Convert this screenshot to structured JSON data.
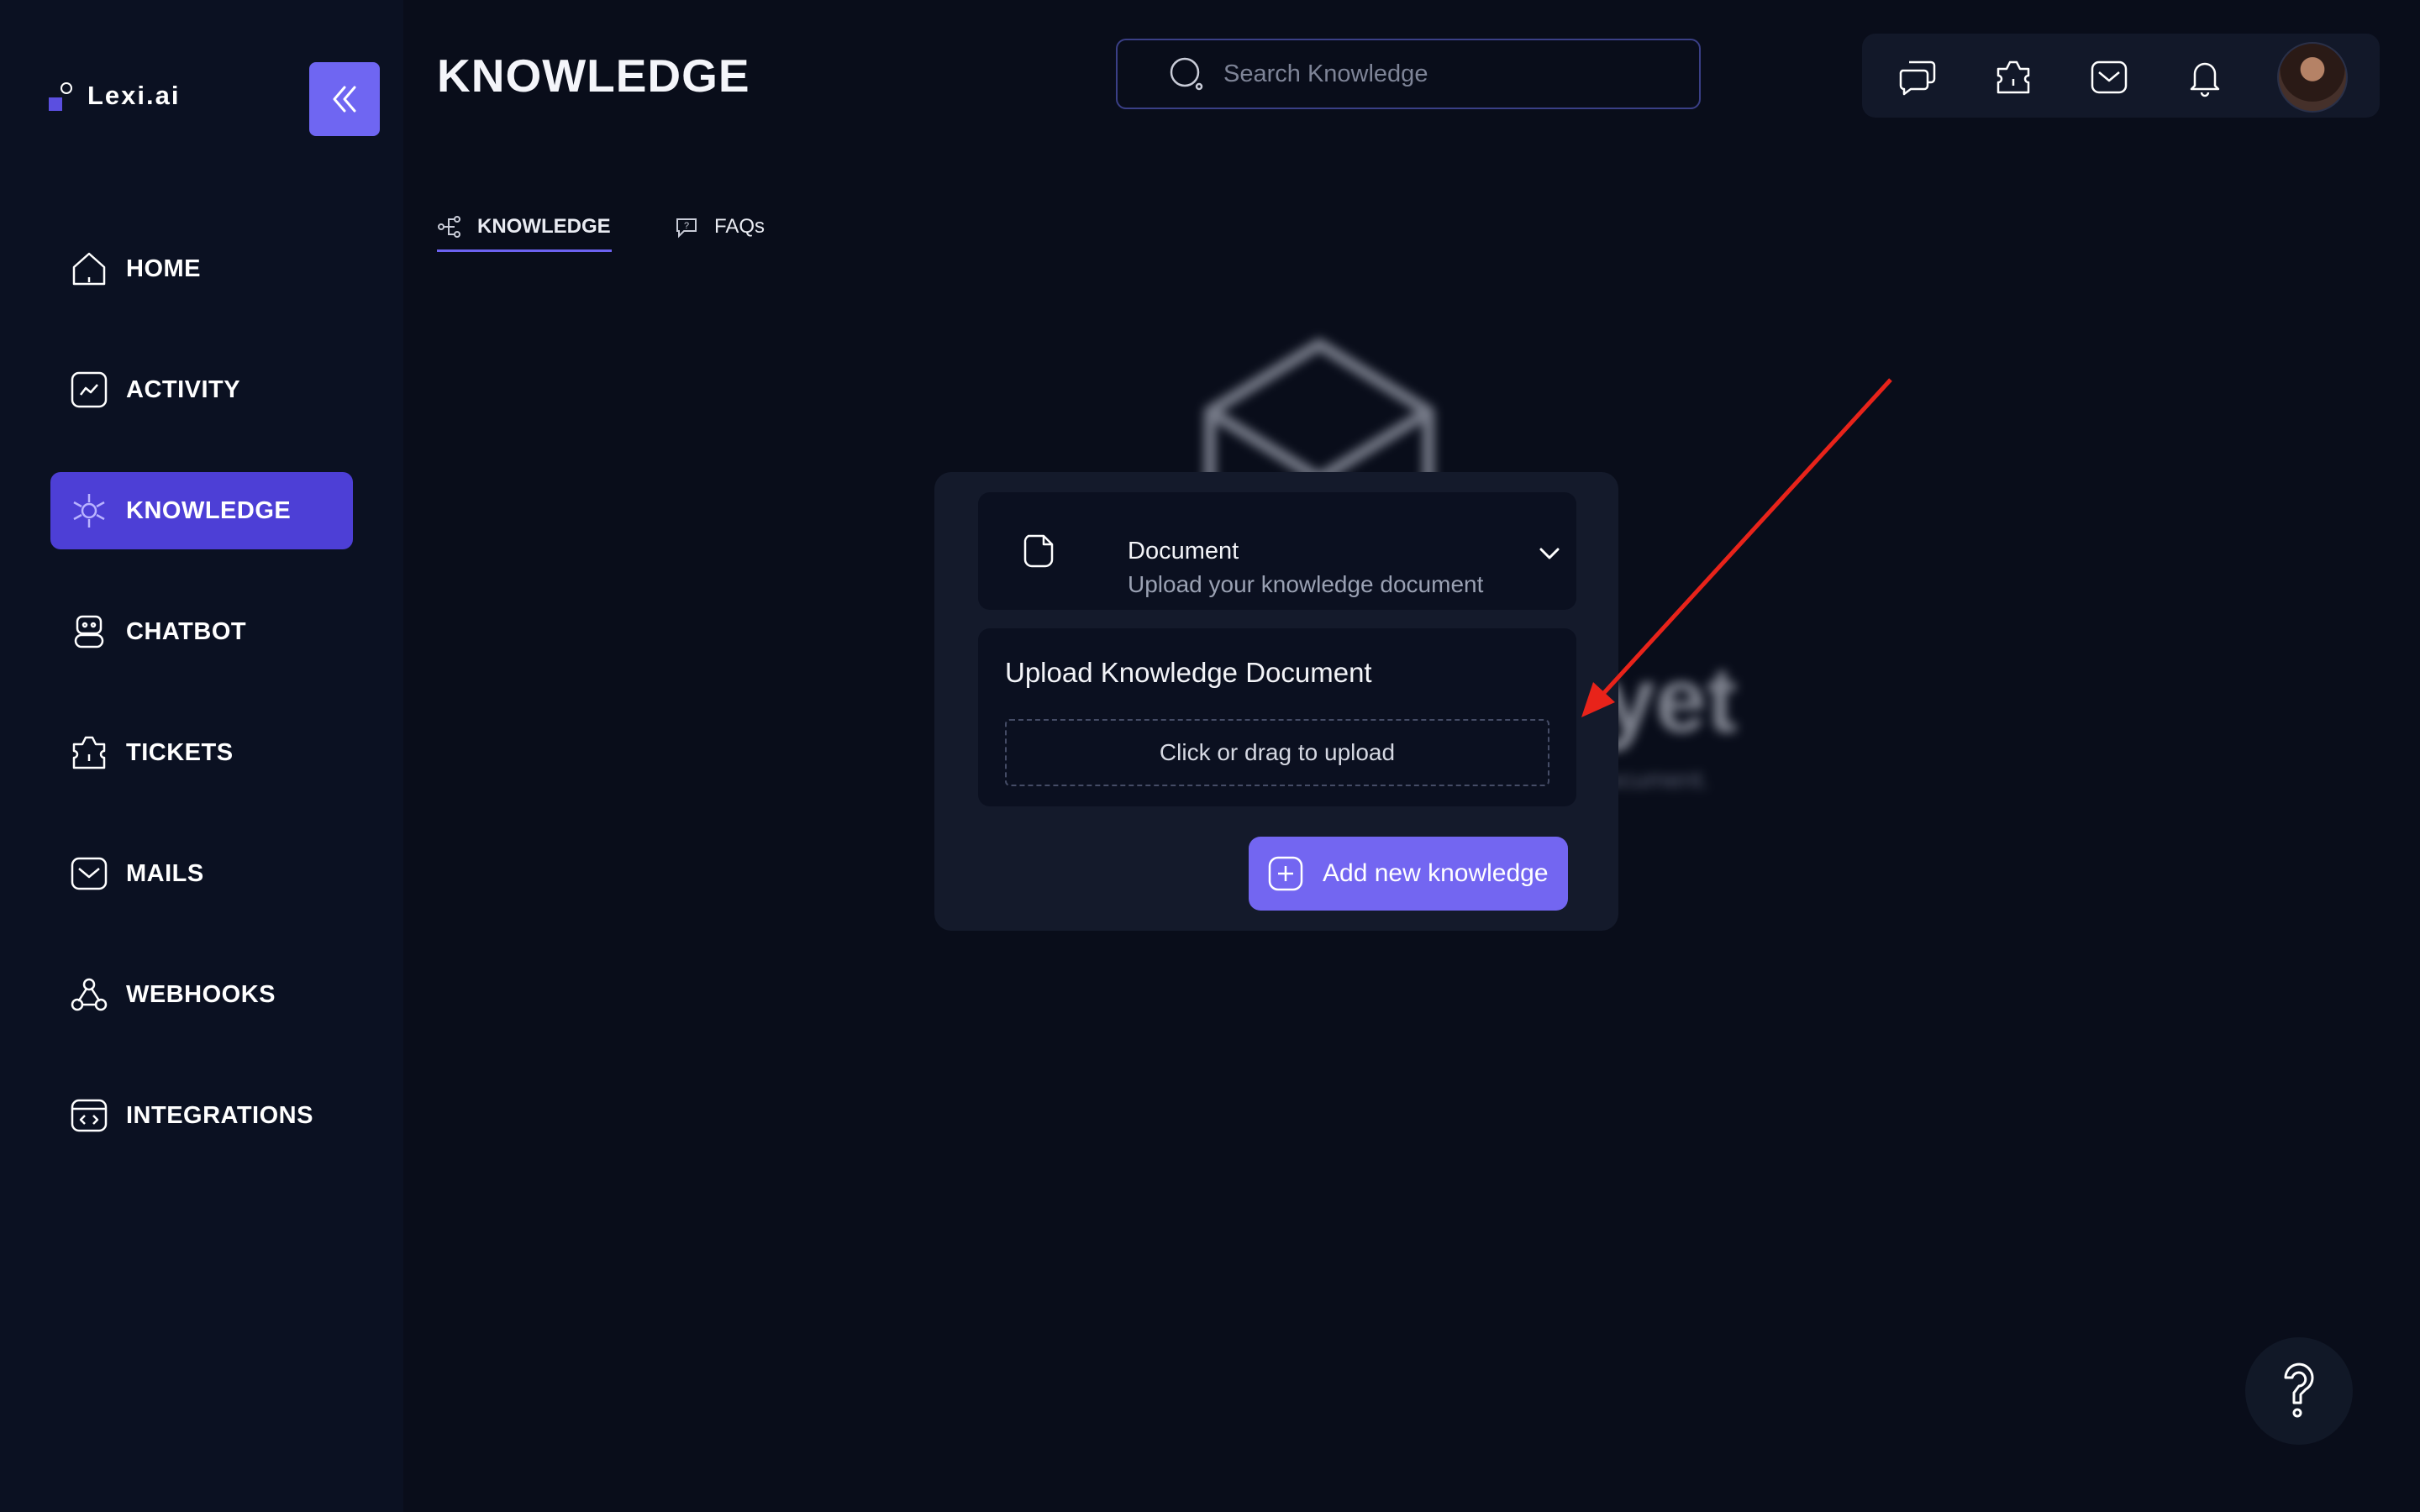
{
  "app": {
    "name": "Lexi.ai"
  },
  "sidebar": {
    "items": [
      {
        "label": "HOME",
        "icon": "home-icon",
        "active": false
      },
      {
        "label": "ACTIVITY",
        "icon": "activity-icon",
        "active": false
      },
      {
        "label": "KNOWLEDGE",
        "icon": "knowledge-icon",
        "active": true
      },
      {
        "label": "CHATBOT",
        "icon": "chatbot-icon",
        "active": false
      },
      {
        "label": "TICKETS",
        "icon": "ticket-icon",
        "active": false
      },
      {
        "label": "MAILS",
        "icon": "mail-icon",
        "active": false
      },
      {
        "label": "WEBHOOKS",
        "icon": "webhook-icon",
        "active": false
      },
      {
        "label": "INTEGRATIONS",
        "icon": "integrations-icon",
        "active": false
      }
    ]
  },
  "header": {
    "title": "KNOWLEDGE",
    "search_placeholder": "Search Knowledge",
    "icons": [
      "chat-icon",
      "ticket-icon",
      "mail-icon",
      "bell-icon",
      "avatar"
    ]
  },
  "tabs": [
    {
      "label": "KNOWLEDGE",
      "icon": "knowledge-tab-icon",
      "active": true
    },
    {
      "label": "FAQs",
      "icon": "faq-icon",
      "active": false
    }
  ],
  "empty_state": {
    "title": "No knowledge yet",
    "subtitle": "Start by adding a new knowledge source or upload your document."
  },
  "modal": {
    "type_title": "Document",
    "type_subtitle": "Upload your knowledge document",
    "upload_heading": "Upload Knowledge Document",
    "dropzone_text": "Click or drag to upload",
    "add_button": "Add new knowledge"
  },
  "colors": {
    "background": "#090d1a",
    "sidebar": "#0b1122",
    "accent": "#4d3fd6",
    "button": "#7366f1",
    "annotation_arrow": "#e8231a"
  }
}
